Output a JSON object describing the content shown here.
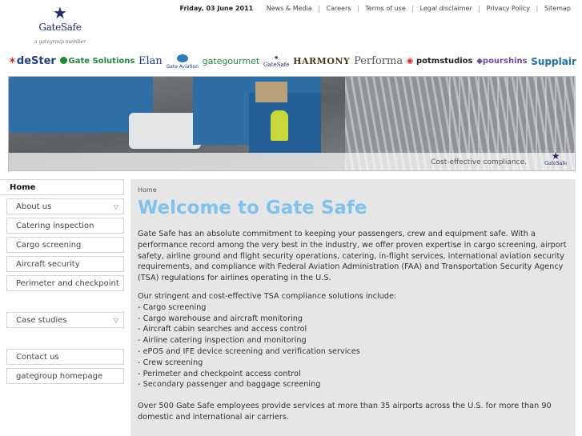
{
  "logo": {
    "name": "GateSafe",
    "tagline": "a gategroup member"
  },
  "topnav": {
    "date": "Friday, 03 June 2011",
    "links": [
      "News & Media",
      "Careers",
      "Terms of use",
      "Legal disclaimer",
      "Privacy Policy",
      "Sitemap"
    ],
    "separator": "|"
  },
  "brands": [
    "deSter",
    "Gate Solutions",
    "Elan",
    "Gate Aviation",
    "gategourmet",
    "GateSafe",
    "HARMONY",
    "Performa",
    "potmstudios",
    "pourshins",
    "Supplair"
  ],
  "banner": {
    "caption": "Cost-effective compliance.",
    "logo_text": "GateSafe"
  },
  "sidebar": {
    "home": "Home",
    "items": [
      {
        "label": "About us",
        "has_dropdown": true
      },
      {
        "label": "Catering inspection",
        "has_dropdown": false
      },
      {
        "label": "Cargo screening",
        "has_dropdown": false
      },
      {
        "label": "Aircraft security",
        "has_dropdown": false
      },
      {
        "label": "Perimeter and checkpoint",
        "has_dropdown": false
      },
      {
        "label": "Case studies",
        "has_dropdown": true
      },
      {
        "label": "Contact us",
        "has_dropdown": false
      },
      {
        "label": "gategroup homepage",
        "has_dropdown": false
      }
    ],
    "chevron_icon": "chevron-down-icon"
  },
  "main": {
    "breadcrumb": "Home",
    "title": "Welcome to Gate Safe",
    "intro": "Gate Safe has an absolute commitment to keeping your passengers, crew and equipment safe. With a performance record among the very best in the industry, we offer proven expertise in cargo screening, airport safety, airline ground and flight security operations, catering, in-flight services, international aviation security requirements, and compliance with Federal Aviation Administration (FAA) and Transportation Security Agency (TSA) regulations for airlines operating in the U.S.",
    "list_intro": "Our stringent and cost-effective TSA compliance solutions include:",
    "list_items": [
      "- Cargo screening",
      "- Cargo warehouse and aircraft monitoring",
      "- Aircraft cabin searches and access control",
      "- Airline catering inspection and monitoring",
      "- ePOS and IFE device screening and verification services",
      "- Crew screening",
      "- Perimeter and checkpoint access control",
      "- Secondary passenger and baggage screening"
    ],
    "closing": "Over 500 Gate Safe employees provide services at more than 35 airports across the U.S. for more than 90 domestic and international air carriers."
  },
  "colors": {
    "title": "#7fc2ec",
    "brand_navy": "#1e2a6b",
    "main_bg": "#e6e6e6"
  }
}
